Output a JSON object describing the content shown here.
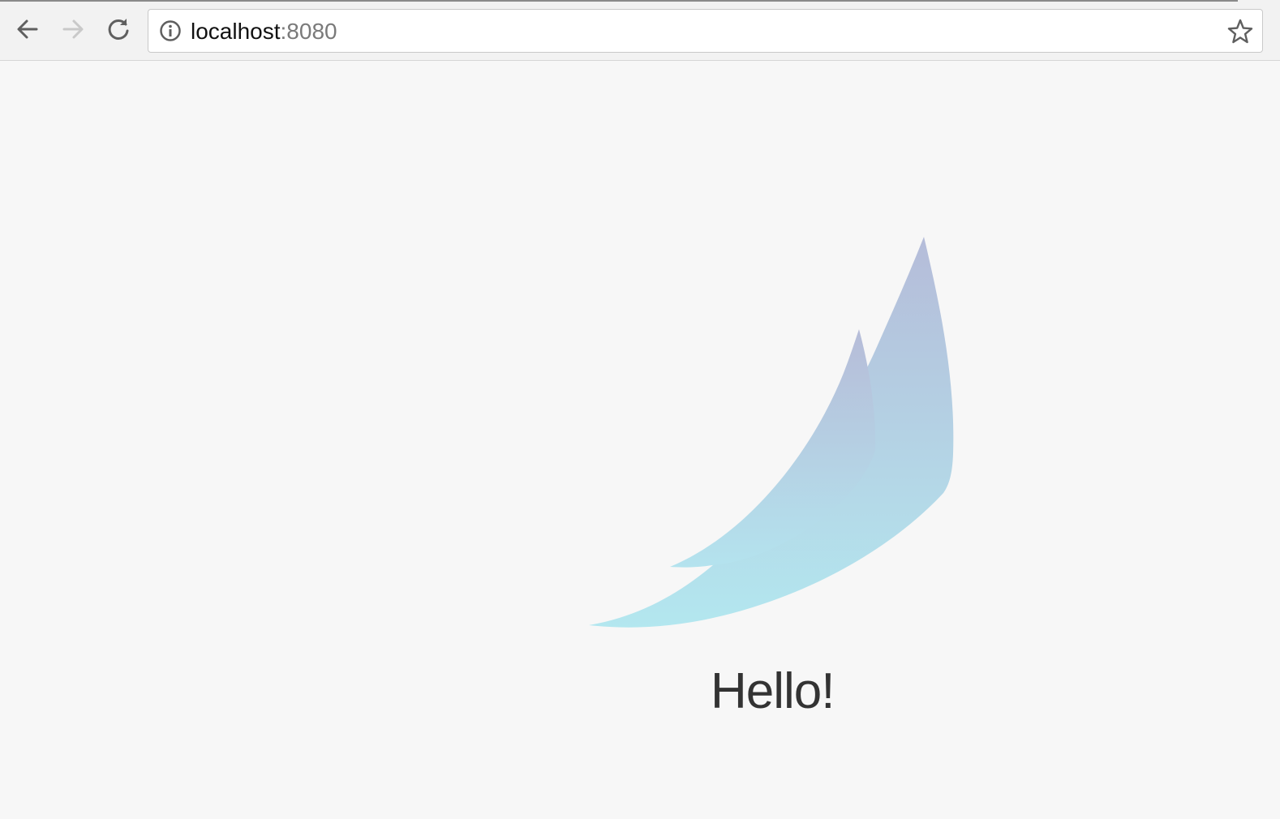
{
  "browser": {
    "url_host": "localhost",
    "url_port": ":8080",
    "icons": {
      "back": "back-arrow-icon",
      "forward": "forward-arrow-icon",
      "reload": "reload-icon",
      "site_info": "info-icon",
      "bookmark": "star-icon"
    }
  },
  "page": {
    "greeting": "Hello!",
    "colors": {
      "background": "#f7f7f7",
      "logo_top": "#b5bcd9",
      "logo_bottom": "#b3e7ef",
      "text": "#333333"
    }
  }
}
